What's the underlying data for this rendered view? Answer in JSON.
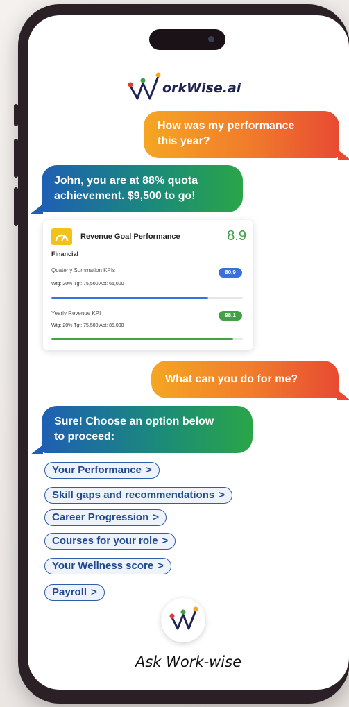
{
  "brand": {
    "name": "orkWise.ai"
  },
  "chat": {
    "user_msg_1_line1": "How was my performance",
    "user_msg_1_line2": "this year?",
    "bot_msg_1_line1": "John, you are at 88% quota",
    "bot_msg_1_line2": "achievement. $9,500 to go!",
    "user_msg_2": "What can you do for me?",
    "bot_msg_2_line1": "Sure! Choose an option below",
    "bot_msg_2_line2": "to proceed:"
  },
  "card": {
    "title": "Revenue Goal Performance",
    "score": "8.9",
    "category": "Financial",
    "kpis": [
      {
        "name": "Quaterly Summation KPIs",
        "meta": "Wtg: 20% Tgt: 75,500 Act: 65,000",
        "badge": "80.9",
        "badge_color": "#3b6fe0",
        "progress": 0.82,
        "bar_color": "#3b6fe0"
      },
      {
        "name": "Yearly Revenue KPI",
        "meta": "Wtg: 20% Tgt: 75,500 Act: 85,000",
        "badge": "98.1",
        "badge_color": "#43a047",
        "progress": 0.95,
        "bar_color": "#43a047"
      }
    ]
  },
  "options": [
    {
      "label": "Your Performance",
      "chevron": ">"
    },
    {
      "label": "Skill gaps and recommendations",
      "chevron": ">"
    },
    {
      "label": "Career Progression",
      "chevron": ">"
    },
    {
      "label": "Courses for your role",
      "chevron": ">"
    },
    {
      "label": "Your Wellness score",
      "chevron": ">"
    },
    {
      "label": "Payroll",
      "chevron": ">"
    }
  ],
  "footer": {
    "ask_label": "Ask Work-wise"
  },
  "colors": {
    "user_bubble": "#f07b2c",
    "bot_bubble": "#1e5fb4",
    "brand_navy": "#1f2352",
    "accent_green": "#43a047"
  }
}
